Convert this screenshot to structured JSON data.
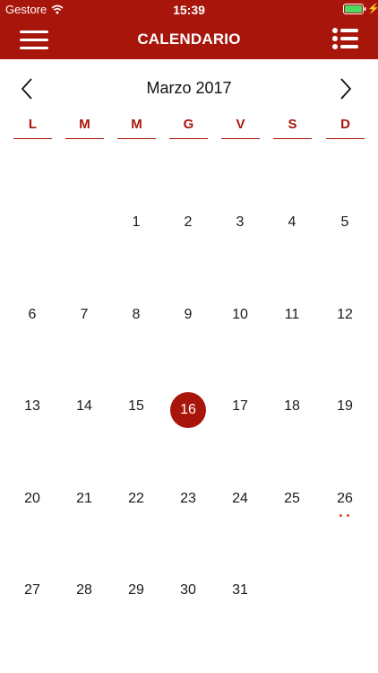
{
  "status_bar": {
    "carrier": "Gestore",
    "time": "15:39"
  },
  "nav": {
    "title": "CALENDARIO"
  },
  "calendar": {
    "month_title": "Marzo 2017",
    "weekdays": [
      "L",
      "M",
      "M",
      "G",
      "V",
      "S",
      "D"
    ],
    "days": [
      "1",
      "2",
      "3",
      "4",
      "5",
      "6",
      "7",
      "8",
      "9",
      "10",
      "11",
      "12",
      "13",
      "14",
      "15",
      "16",
      "17",
      "18",
      "19",
      "20",
      "21",
      "22",
      "23",
      "24",
      "25",
      "26",
      "27",
      "28",
      "29",
      "30",
      "31"
    ],
    "today": "16",
    "event_day": "26"
  },
  "colors": {
    "accent": "#a8150b",
    "event_dot": "#d9531e"
  }
}
